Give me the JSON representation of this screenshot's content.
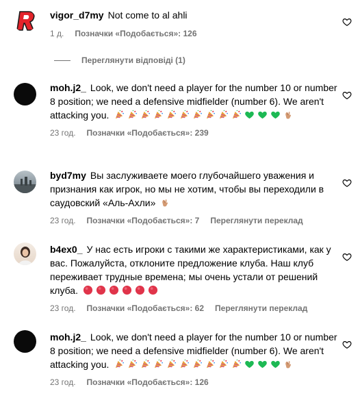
{
  "comments": [
    {
      "username": "vigor_d7my",
      "text": "Not come to al ahli",
      "time": "1 д.",
      "likes": "Позначки «Подобається»: 126",
      "avatar_letter": "R"
    },
    {
      "username": "moh.j2_",
      "text": "Look, we don't need a player for the number 10 or number 8 position; we need a defensive midfielder (number 6). We aren't attacking you.",
      "time": "23 год.",
      "likes": "Позначки «Подобається»: 239"
    },
    {
      "username": "byd7my",
      "text": "Вы заслуживаете моего глубочайшего уважения и признания как игрок, но мы не хотим, чтобы вы переходили в саудовский «Аль-Ахли»",
      "time": "23 год.",
      "likes": "Позначки «Подобається»: 7",
      "translate": "Переглянути переклад"
    },
    {
      "username": "b4ex0_",
      "text": "У нас есть игроки с такими же характеристиками, как у вас. Пожалуйста, отклоните предложение клуба. Наш клуб переживает трудные времена; мы очень устали от решений клуба.",
      "time": "23 год.",
      "likes": "Позначки «Подобається»: 62",
      "translate": "Переглянути переклад"
    },
    {
      "username": "moh.j2_",
      "text": "Look, we don't need a player for the number 10 or number 8 position; we need a defensive midfielder (number 6). We aren't attacking you.",
      "time": "23 год.",
      "likes": "Позначки «Подобається»: 126"
    }
  ],
  "view_replies": "Переглянути відповіді (1)",
  "colors": {
    "text": "#000000",
    "secondary": "#737373",
    "logo_red": "#e3242b",
    "green_heart": "#1db954",
    "red_circle": "#e0344a"
  },
  "icons": [
    "heart-outline-icon",
    "party-popper-emoji",
    "green-heart-emoji",
    "clapping-hands-emoji",
    "red-circle-emoji"
  ]
}
